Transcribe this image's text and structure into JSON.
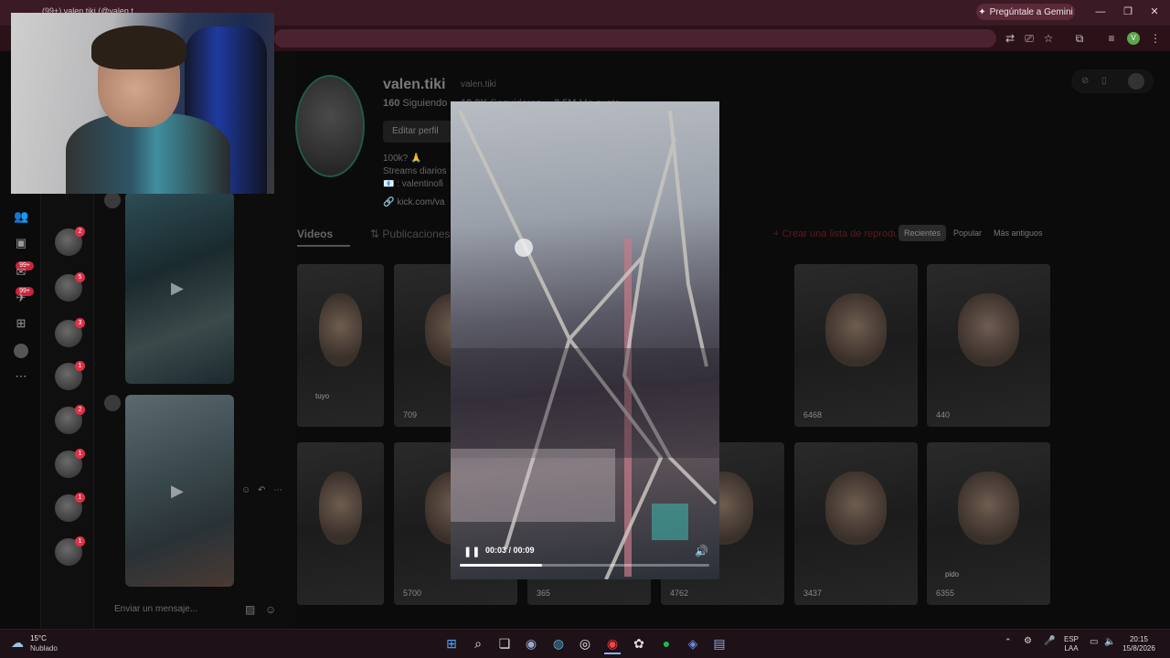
{
  "browser": {
    "tab_title": "(99+) valen.tiki (@valen.tiki)",
    "gemini_label": "Pregúntale a Gemini",
    "profile_initial": "V"
  },
  "profile": {
    "display_name": "valen.tiki",
    "username": "valen.tiki",
    "following_count": "160",
    "following_label": "Siguiendo",
    "followers_count": "19,9K",
    "followers_label": "Seguidores",
    "likes_count": "2,5M",
    "likes_label": "Me gusta",
    "edit_button": "Editar perfil",
    "bio_line1": "100k? 🙏",
    "bio_line2": "Streams diarios",
    "bio_line3": "📧 : valentinofi",
    "link": "kick.com/va"
  },
  "tabs": {
    "videos": "Videos",
    "posts": "Publicaciones",
    "create_list": "Crear una lista de reproducción",
    "sort_recent": "Recientes",
    "sort_popular": "Popular",
    "sort_oldest": "Más antiguos"
  },
  "videos": [
    {
      "count": "",
      "caption": "tuyo"
    },
    {
      "count": "709",
      "caption": ""
    },
    {
      "count": "",
      "caption": ""
    },
    {
      "count": "6468",
      "caption": ""
    },
    {
      "count": "440",
      "caption": ""
    },
    {
      "count": "",
      "caption": ""
    },
    {
      "count": "5700",
      "caption": ""
    },
    {
      "count": "365",
      "caption": ""
    },
    {
      "count": "4762",
      "caption": ""
    },
    {
      "count": "3437",
      "caption": ""
    },
    {
      "count": "6355",
      "caption": "pido"
    }
  ],
  "left_rail": {
    "badge_1": "99+",
    "badge_2": "99+"
  },
  "dm_badges": [
    "2",
    "5",
    "3",
    "1",
    "2",
    "1",
    "1",
    "1"
  ],
  "chat": {
    "message_placeholder": "Enviar un mensaje..."
  },
  "player": {
    "time": "00:03 / 00:09",
    "progress": 0.33
  },
  "taskbar": {
    "temp": "15°C",
    "weather": "Nublado",
    "lang_1": "ESP",
    "lang_2": "LAA",
    "time": "20:15",
    "date": "15/8/2026"
  }
}
